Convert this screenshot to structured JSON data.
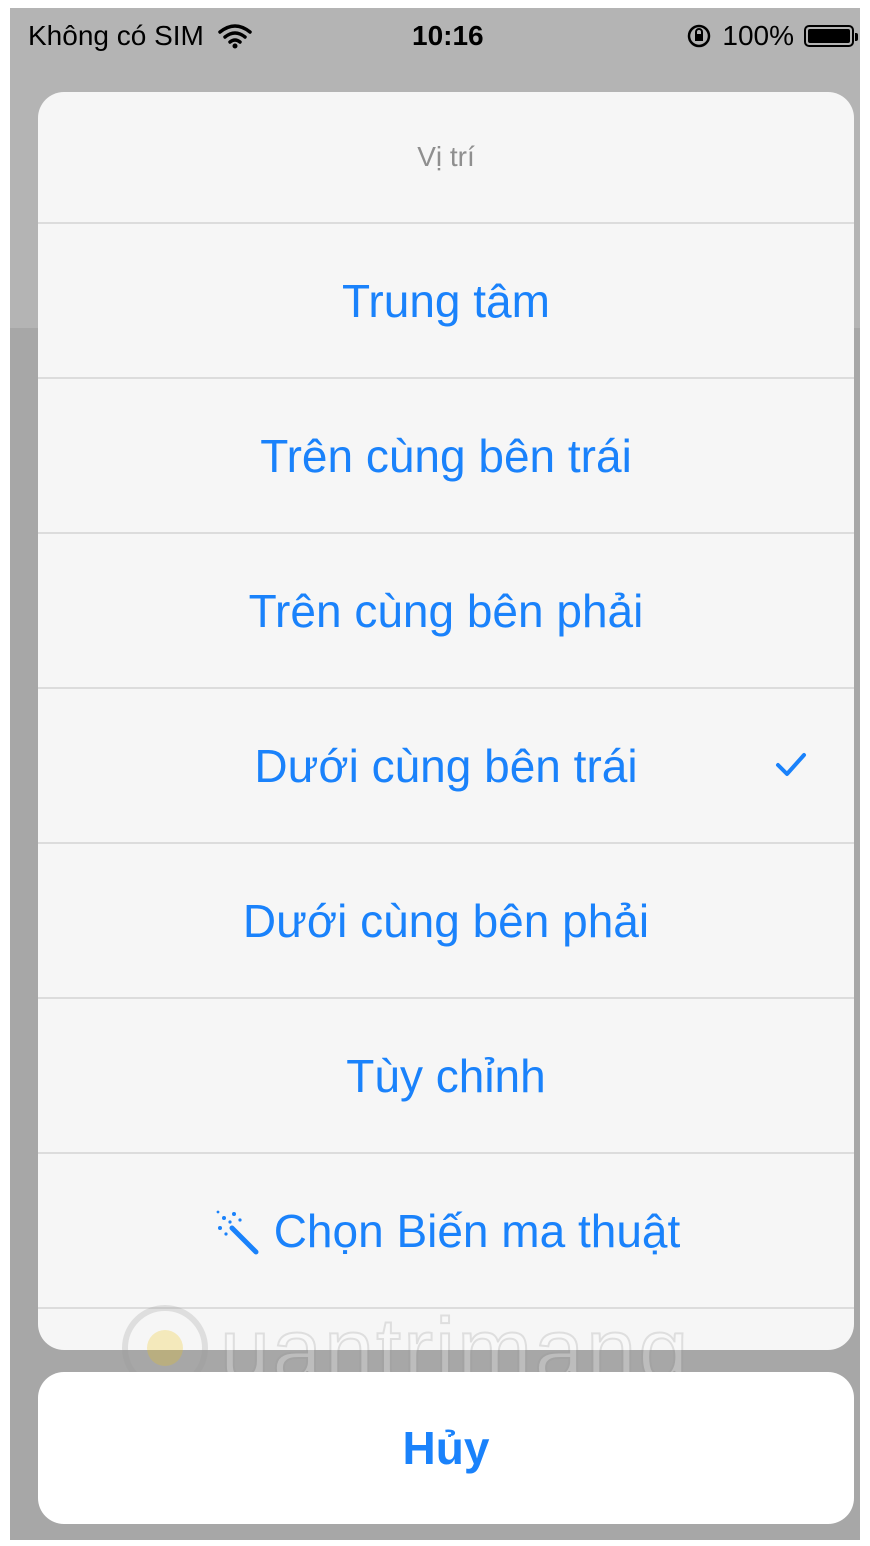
{
  "status_bar": {
    "carrier": "Không có SIM",
    "time": "10:16",
    "battery": "100%"
  },
  "sheet": {
    "title": "Vị trí",
    "items": [
      {
        "label": "Trung tâm"
      },
      {
        "label": "Trên cùng bên trái"
      },
      {
        "label": "Trên cùng bên phải"
      },
      {
        "label": "Dưới cùng bên trái"
      },
      {
        "label": "Dưới cùng bên phải"
      },
      {
        "label": "Tùy chỉnh"
      },
      {
        "label": "Chọn Biến ma thuật",
        "icon": "magic-wand-icon"
      }
    ],
    "selected_index": 3
  },
  "cancel": {
    "label": "Hủy"
  },
  "watermark": {
    "text": "uantrimang"
  },
  "colors": {
    "accent": "#1a82fb",
    "overlay": "#a7a7a7",
    "sheet_bg": "#f6f6f6"
  }
}
